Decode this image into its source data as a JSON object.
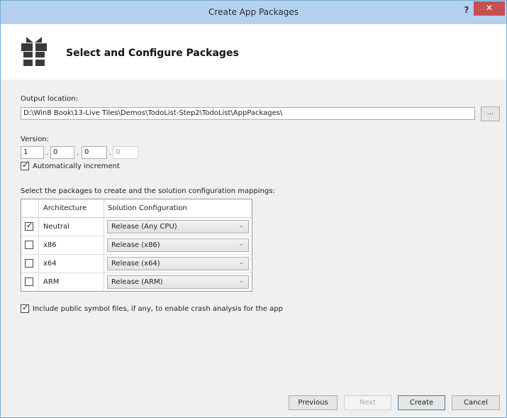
{
  "window": {
    "title": "Create App Packages",
    "help_label": "?",
    "close_label": "✕"
  },
  "header": {
    "title": "Select and Configure Packages",
    "icon": "gift-package-icon"
  },
  "output": {
    "label": "Output location:",
    "value": "D:\\Win8 Book\\13-Live Tiles\\Demos\\TodoList-Step2\\TodoList\\AppPackages\\",
    "browse_label": "..."
  },
  "version": {
    "label": "Version:",
    "parts": [
      "1",
      "0",
      "0",
      "0"
    ],
    "separator": ".",
    "auto_increment_label": "Automatically increment",
    "auto_increment_checked": true
  },
  "packages": {
    "label": "Select the packages to create and the solution configuration mappings:",
    "headers": {
      "architecture": "Architecture",
      "configuration": "Solution Configuration"
    },
    "rows": [
      {
        "architecture": "Neutral",
        "configuration": "Release (Any CPU)",
        "checked": true
      },
      {
        "architecture": "x86",
        "configuration": "Release (x86)",
        "checked": false
      },
      {
        "architecture": "x64",
        "configuration": "Release (x64)",
        "checked": false
      },
      {
        "architecture": "ARM",
        "configuration": "Release (ARM)",
        "checked": false
      }
    ],
    "check_glyph": "✓"
  },
  "symbols": {
    "label": "Include public symbol files, if any, to enable crash analysis for the app",
    "checked": true
  },
  "buttons": {
    "previous": "Previous",
    "next": "Next",
    "create": "Create",
    "cancel": "Cancel"
  },
  "colors": {
    "titlebar": "#b4d2ee",
    "close": "#c75050",
    "accent_border": "#3c7fb1"
  }
}
